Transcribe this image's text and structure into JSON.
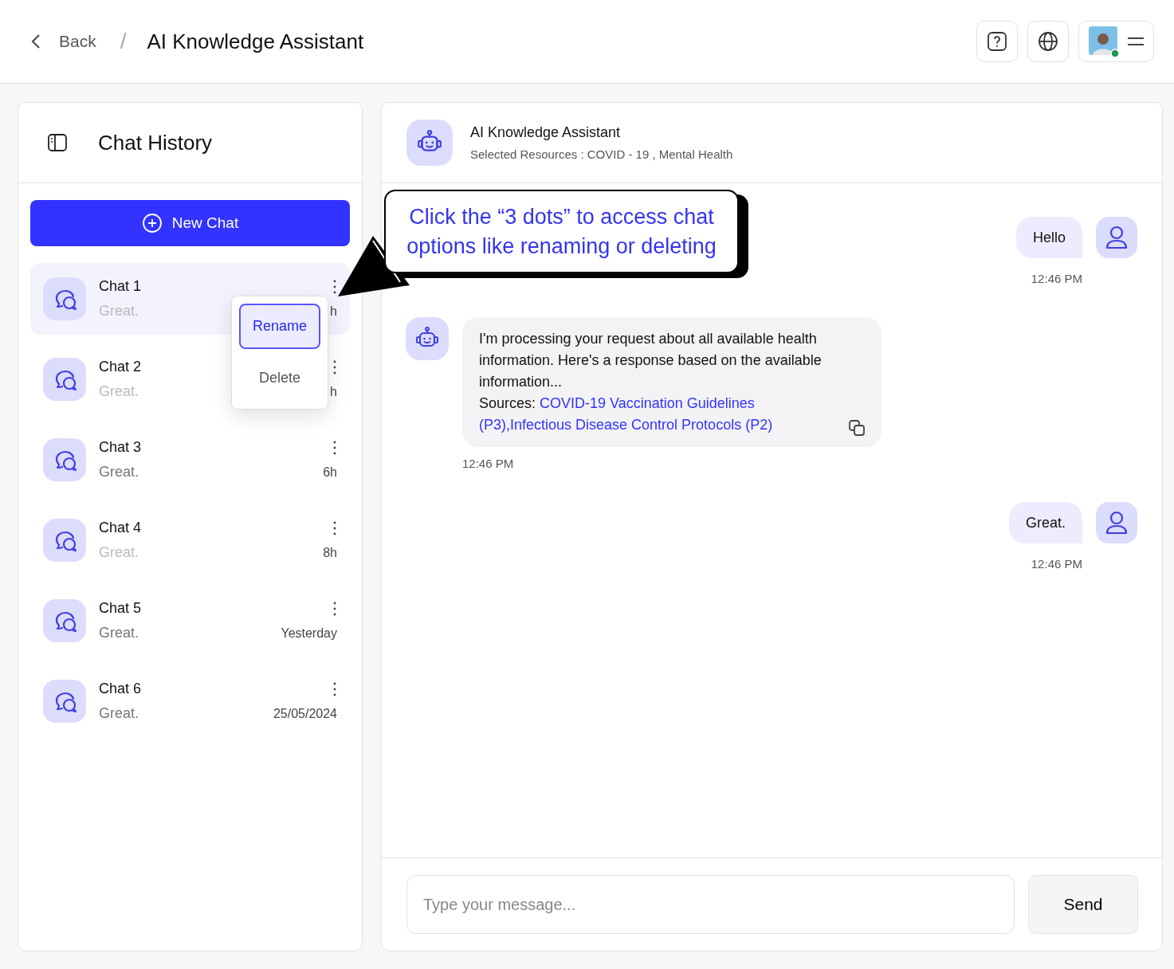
{
  "header": {
    "back": "Back",
    "separator": "/",
    "title": "AI Knowledge Assistant"
  },
  "sidebar": {
    "title": "Chat History",
    "new_chat": "New Chat",
    "chats": [
      {
        "name": "Chat 1",
        "preview": "Great.",
        "time": "h",
        "selected": true,
        "dimmed": true
      },
      {
        "name": "Chat 2",
        "preview": "Great.",
        "time": "h",
        "selected": false,
        "dimmed": true
      },
      {
        "name": "Chat 3",
        "preview": "Great.",
        "time": "6h",
        "selected": false,
        "dimmed": false
      },
      {
        "name": "Chat 4",
        "preview": "Great.",
        "time": "8h",
        "selected": false,
        "dimmed": true
      },
      {
        "name": "Chat 5",
        "preview": "Great.",
        "time": "Yesterday",
        "selected": false,
        "dimmed": false
      },
      {
        "name": "Chat 6",
        "preview": "Great.",
        "time": "25/05/2024",
        "selected": false,
        "dimmed": false
      }
    ]
  },
  "menu": {
    "items": [
      {
        "label": "Rename",
        "selected": true
      },
      {
        "label": "Delete",
        "selected": false
      }
    ]
  },
  "assistant": {
    "name": "AI Knowledge Assistant",
    "resources": "Selected Resources : COVID - 19 , Mental Health"
  },
  "messages": [
    {
      "kind": "user",
      "text": "Hello",
      "time": "12:46 PM"
    },
    {
      "kind": "bot",
      "text": "I'm processing your request about all available health information. Here's a response based on the available information...",
      "sources_label": "Sources:",
      "sources": [
        "COVID-19 Vaccination Guidelines",
        "(P3),Infectious Disease Control Protocols (P2)"
      ],
      "time": "12:46 PM"
    },
    {
      "kind": "user",
      "text": "Great.",
      "time": "12:46 PM"
    }
  ],
  "composer": {
    "placeholder": "Type your message...",
    "send": "Send"
  },
  "callout": {
    "text": "Click the “3 dots” to access chat options like renaming or deleting"
  }
}
